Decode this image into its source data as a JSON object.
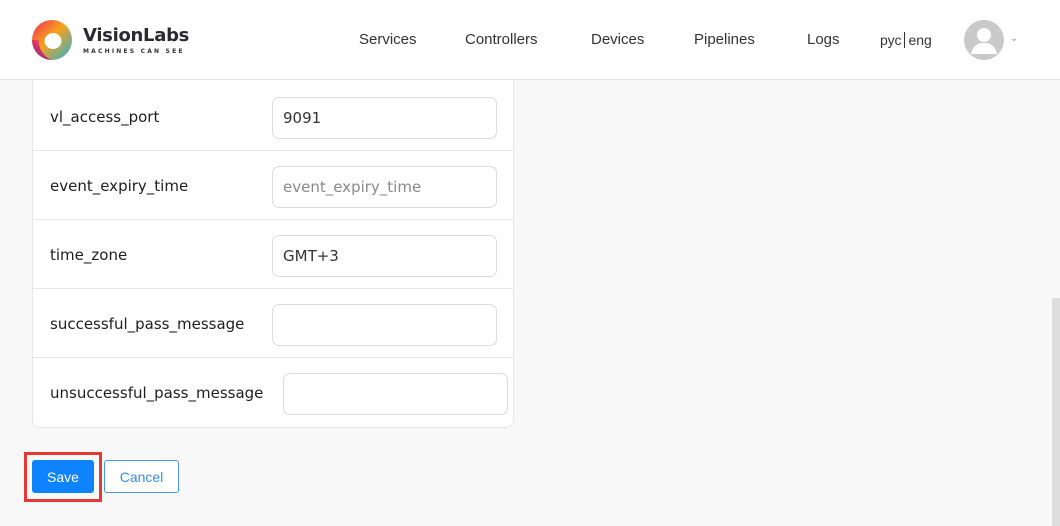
{
  "brand": {
    "name": "VisionLabs",
    "tagline": "MACHINES CAN SEE"
  },
  "nav": {
    "items": [
      {
        "label": "Services"
      },
      {
        "label": "Controllers"
      },
      {
        "label": "Devices"
      },
      {
        "label": "Pipelines"
      },
      {
        "label": "Logs"
      }
    ],
    "lang_ru": "рус",
    "lang_en": "eng",
    "user_icon": "user-avatar-icon",
    "menu_icon": "chevron-down-icon"
  },
  "form": {
    "fields": [
      {
        "label": "vl_access_port",
        "value": "9091",
        "placeholder": ""
      },
      {
        "label": "event_expiry_time",
        "value": "",
        "placeholder": "event_expiry_time"
      },
      {
        "label": "time_zone",
        "value": "GMT+3",
        "placeholder": ""
      },
      {
        "label": "successful_pass_message",
        "value": "",
        "placeholder": ""
      },
      {
        "label": "unsuccessful_pass_message",
        "value": "",
        "placeholder": ""
      }
    ]
  },
  "actions": {
    "save_label": "Save",
    "cancel_label": "Cancel"
  },
  "colors": {
    "primary": "#0d83fd",
    "highlight": "#e53935"
  }
}
